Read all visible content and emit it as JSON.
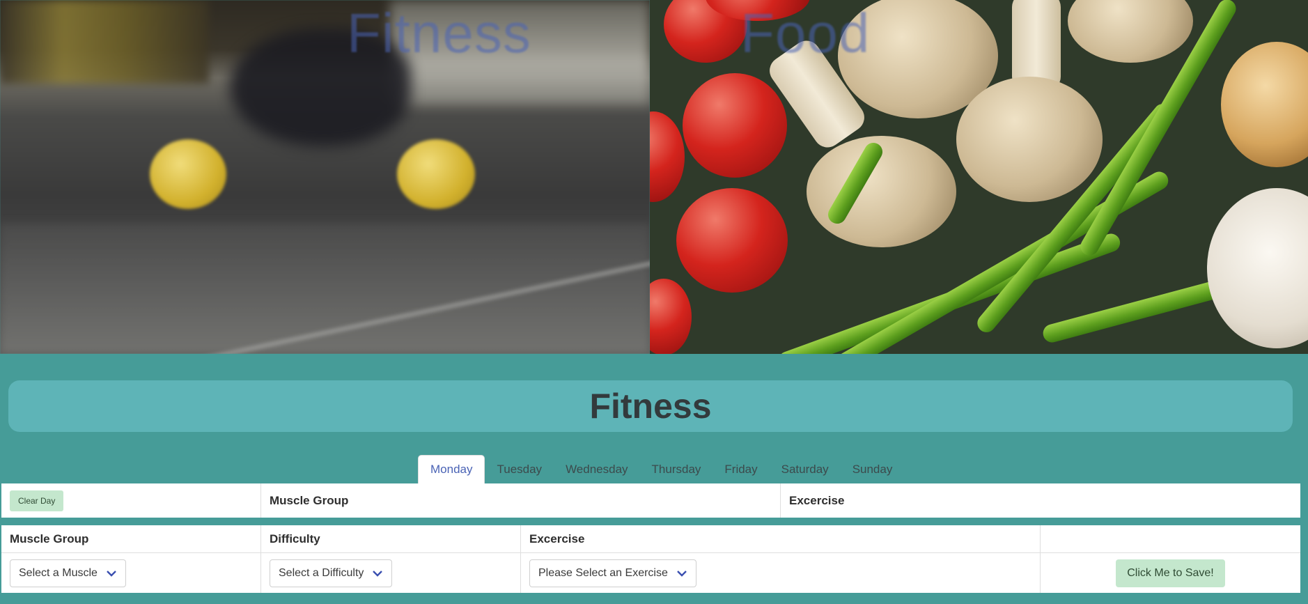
{
  "hero": {
    "fitness_label": "Fitness",
    "food_label": "Food"
  },
  "page": {
    "title": "Fitness"
  },
  "tabs": [
    {
      "label": "Monday",
      "active": true
    },
    {
      "label": "Tuesday",
      "active": false
    },
    {
      "label": "Wednesday",
      "active": false
    },
    {
      "label": "Thursday",
      "active": false
    },
    {
      "label": "Friday",
      "active": false
    },
    {
      "label": "Saturday",
      "active": false
    },
    {
      "label": "Sunday",
      "active": false
    }
  ],
  "day_table": {
    "clear_button": "Clear Day",
    "headers": [
      "Muscle Group",
      "Excercise"
    ]
  },
  "entry_table": {
    "headers": [
      "Muscle Group",
      "Difficulty",
      "Excercise",
      ""
    ],
    "muscle_select": "Select a Muscle",
    "difficulty_select": "Select a Difficulty",
    "exercise_select": "Please Select an Exercise",
    "save_button": "Click Me to Save!"
  },
  "colors": {
    "background": "#469c98",
    "title_bar": "#5eb4b7",
    "accent": "#4a63b5",
    "button_green": "#c4e7cd"
  },
  "icons": {
    "dropdown": "chevron-down-icon"
  }
}
